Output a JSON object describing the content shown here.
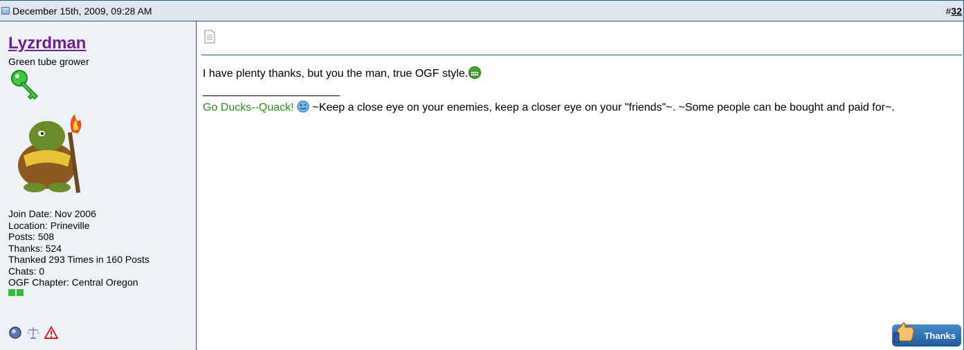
{
  "header": {
    "date": "December 15th, 2009, 09:28 AM",
    "post_prefix": "#",
    "post_number": "32"
  },
  "user": {
    "username": "Lyzrdman",
    "title": "Green tube grower",
    "info": [
      "Join Date: Nov 2006",
      "Location: Prineville",
      "Posts: 508",
      "Thanks: 524",
      "Thanked 293 Times in 160 Posts",
      "Chats: 0",
      "OGF Chapter: Central Oregon"
    ],
    "icons": [
      "online-status-icon",
      "reputation-icon",
      "report-icon"
    ]
  },
  "post": {
    "message": "I have plenty thanks, but you the man, true OGF style.",
    "signature_link": "Go Ducks--Quack!",
    "signature_text": " ~Keep a close eye on your enemies, keep a closer eye on your \"friends\"~. ~Some people can be bought and paid for~."
  },
  "thanks_button": {
    "label": "Thanks"
  },
  "colors": {
    "border": "#1f5f7f",
    "username": "#6c1f94",
    "sig_link": "#2e8b22"
  }
}
